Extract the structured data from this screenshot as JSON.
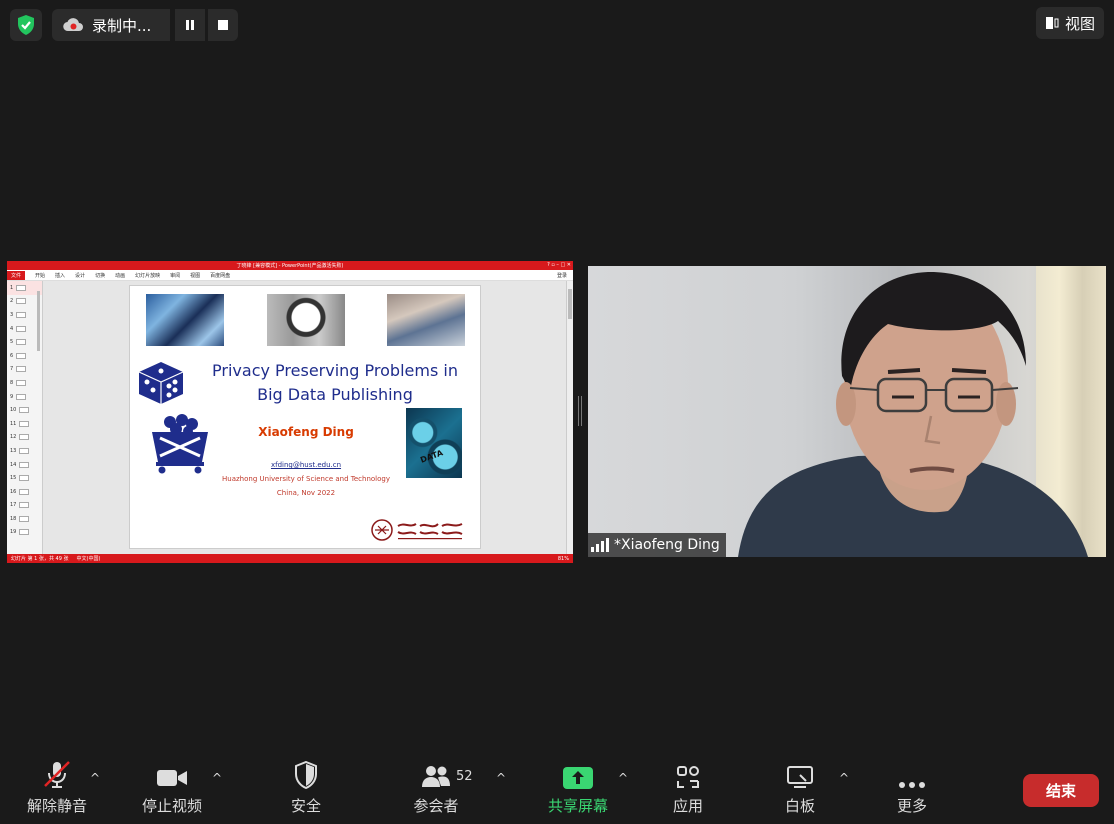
{
  "top_bar": {
    "recording_label": "录制中...",
    "view_label": "视图"
  },
  "shared_screen": {
    "ppt_window_title": "丁晓锋 [兼容模式] - PowerPoint(产品激活失败)",
    "ppt_tabs": [
      "文件",
      "开始",
      "插入",
      "设计",
      "切换",
      "动画",
      "幻灯片放映",
      "审阅",
      "视图",
      "百度网盘"
    ],
    "ppt_login": "登录",
    "slide_numbers": [
      "1",
      "2",
      "3",
      "4",
      "5",
      "6",
      "7",
      "8",
      "9",
      "10",
      "11",
      "12",
      "13",
      "14",
      "15",
      "16",
      "17",
      "18",
      "19"
    ],
    "status_left": "幻灯片 第 1 张，共 49 张",
    "status_lang": "中文(中国)",
    "status_zoom": "81%",
    "slide": {
      "title_line1": "Privacy Preserving Problems in",
      "title_line2": "Big Data Publishing",
      "author": "Xiaofeng Ding",
      "email": "xfding@hust.edu.cn",
      "university": "Huazhong University of Science and Technology",
      "date": "China, Nov 2022",
      "gear_text": "DATA"
    }
  },
  "video": {
    "participant_name": "*Xiaofeng Ding"
  },
  "toolbar": {
    "unmute": "解除静音",
    "stop_video": "停止视频",
    "security": "安全",
    "participants": "参会者",
    "participants_count": "52",
    "share_screen": "共享屏幕",
    "apps": "应用",
    "whiteboard": "白板",
    "more": "更多",
    "end": "结束"
  },
  "colors": {
    "background": "#1a1a1a",
    "share_green": "#3ad672",
    "end_red": "#c72c2c",
    "security_green": "#22c55e",
    "ppt_red": "#d7191c"
  }
}
